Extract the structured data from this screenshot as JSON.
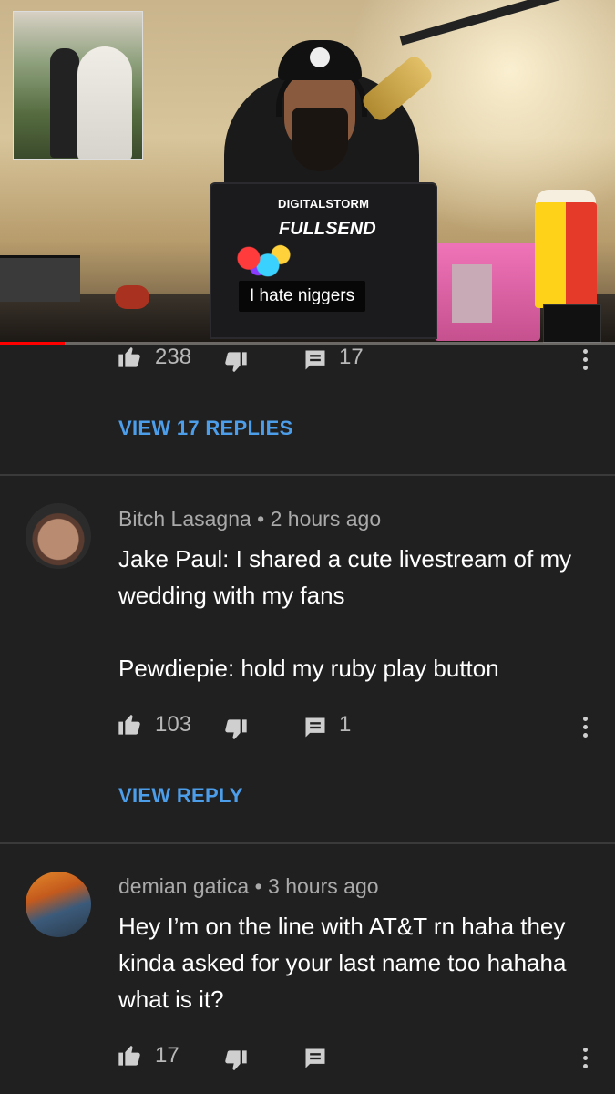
{
  "video": {
    "laptop_brand": "DIGITALSTORM",
    "laptop_model": "FULLSEND",
    "caption": "I hate niggers",
    "progress": 0.105
  },
  "comments": [
    {
      "likes": "238",
      "reply_count": "17",
      "view_replies_label": "VIEW 17 REPLIES"
    },
    {
      "author": "Bitch Lasagna",
      "separator": "•",
      "time": "2 hours ago",
      "text": "Jake Paul: I shared a cute livestream of my wedding with my fans\n\nPewdiepie: hold my ruby play button",
      "likes": "103",
      "reply_count": "1",
      "view_replies_label": "VIEW REPLY"
    },
    {
      "author": "demian gatica",
      "separator": "•",
      "time": "3 hours ago",
      "text": "Hey I’m on the line with AT&T rn haha they kinda asked for your last name too hahaha what is it?",
      "likes": "17"
    }
  ],
  "icons": {
    "like": "thumbs-up-icon",
    "dislike": "thumbs-down-icon",
    "reply": "comment-icon",
    "more": "more-vert-icon"
  },
  "colors": {
    "background": "#202020",
    "link": "#4d9eea",
    "progress": "#ff0000"
  }
}
